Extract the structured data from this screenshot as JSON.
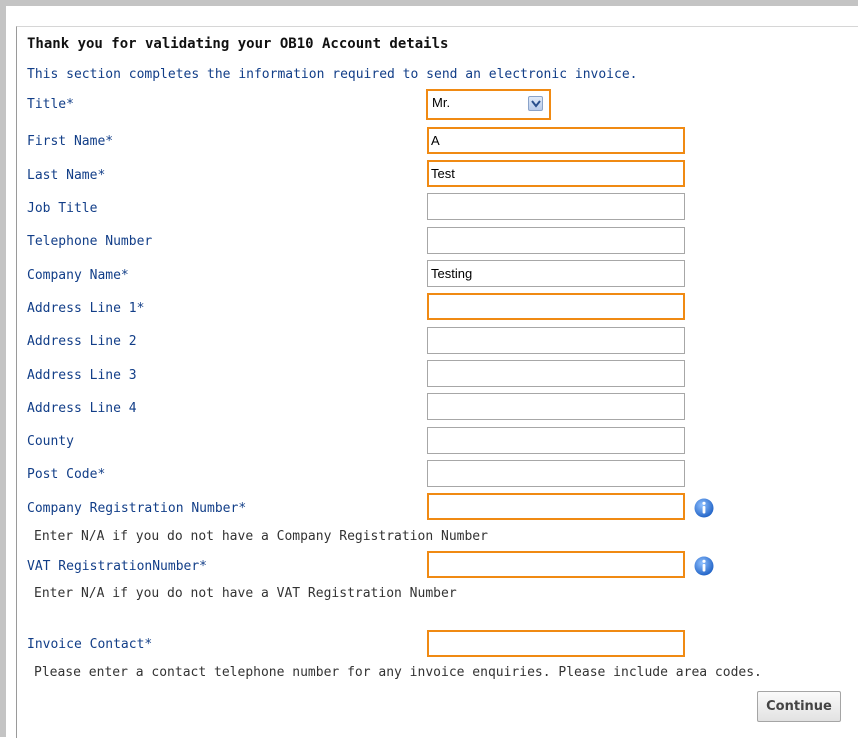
{
  "heading": "Thank you for validating your OB10 Account details",
  "intro": "This section completes the information required to send an electronic invoice.",
  "colors": {
    "label": "#123e88",
    "required_border": "#f08a13",
    "default_border": "#a7a7a7"
  },
  "fields": {
    "title": {
      "label": "Title*",
      "value": "Mr."
    },
    "first_name": {
      "label": "First Name*",
      "value": "A"
    },
    "last_name": {
      "label": "Last Name*",
      "value": "Test"
    },
    "job_title": {
      "label": "Job Title",
      "value": ""
    },
    "telephone": {
      "label": "Telephone Number",
      "value": ""
    },
    "company_name": {
      "label": "Company Name*",
      "value": "Testing"
    },
    "address1": {
      "label": "Address Line 1*",
      "value": ""
    },
    "address2": {
      "label": "Address Line 2",
      "value": ""
    },
    "address3": {
      "label": "Address Line 3",
      "value": ""
    },
    "address4": {
      "label": "Address Line 4",
      "value": ""
    },
    "county": {
      "label": "County",
      "value": ""
    },
    "post_code": {
      "label": "Post Code*",
      "value": ""
    },
    "company_reg": {
      "label": "Company Registration Number*",
      "value": "",
      "hint": "Enter N/A if you do not have a Company Registration Number",
      "icon": "info-icon"
    },
    "vat_reg": {
      "label": "VAT RegistrationNumber*",
      "value": "",
      "hint": "Enter N/A if you do not have a VAT Registration Number",
      "icon": "info-icon"
    },
    "invoice_contact": {
      "label": "Invoice Contact*",
      "value": "",
      "hint": "Please enter a contact telephone number for any invoice enquiries. Please include area codes."
    }
  },
  "continue_label": "Continue"
}
